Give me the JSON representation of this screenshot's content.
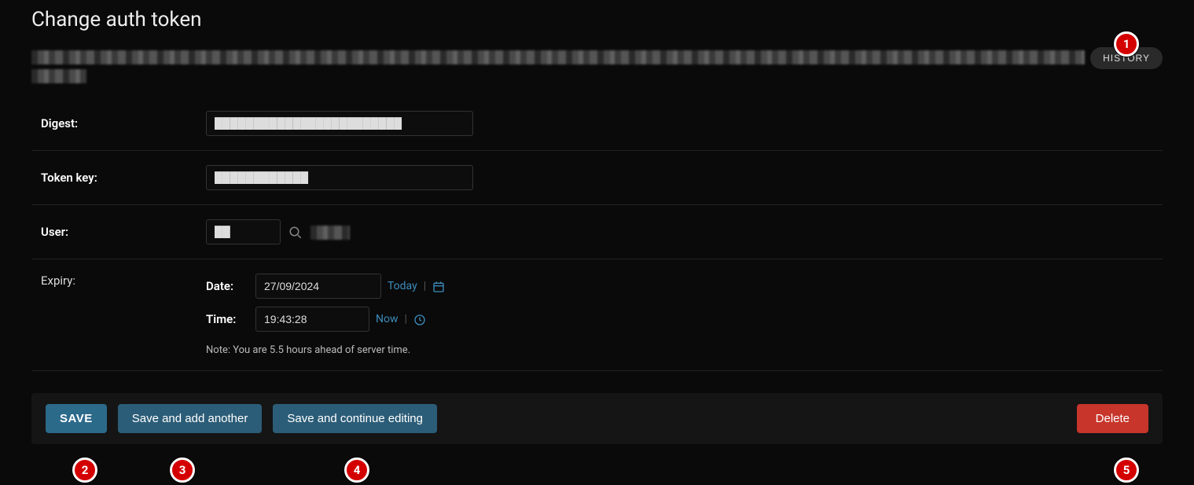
{
  "page_title": "Change auth token",
  "history_button": "HISTORY",
  "fields": {
    "digest": {
      "label": "Digest:",
      "value": "████████████████████████"
    },
    "token_key": {
      "label": "Token key:",
      "value": "████████████"
    },
    "user": {
      "label": "User:",
      "value": "██",
      "link_text": "████"
    },
    "expiry": {
      "label": "Expiry:",
      "date_label": "Date:",
      "date_value": "27/09/2024",
      "today_link": "Today",
      "time_label": "Time:",
      "time_value": "19:43:28",
      "now_link": "Now",
      "note": "Note: You are 5.5 hours ahead of server time."
    }
  },
  "buttons": {
    "save": "SAVE",
    "save_add_another": "Save and add another",
    "save_continue": "Save and continue editing",
    "delete": "Delete"
  },
  "markers": [
    "1",
    "2",
    "3",
    "4",
    "5"
  ]
}
